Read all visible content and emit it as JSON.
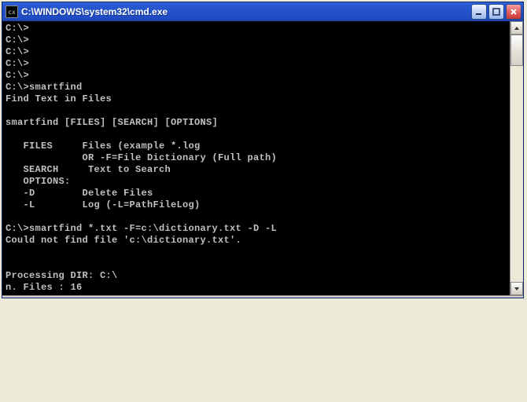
{
  "window": {
    "title": "C:\\WINDOWS\\system32\\cmd.exe",
    "icon_label": "cx"
  },
  "terminal_lines": [
    "C:\\>",
    "C:\\>",
    "C:\\>",
    "C:\\>",
    "C:\\>",
    "C:\\>smartfind",
    "Find Text in Files",
    "",
    "smartfind [FILES] [SEARCH] [OPTIONS]",
    "",
    "   FILES     Files (example *.log",
    "             OR -F=File Dictionary (Full path)",
    "   SEARCH     Text to Search",
    "   OPTIONS:",
    "   -D        Delete Files",
    "   -L        Log (-L=PathFileLog)",
    "",
    "C:\\>smartfind *.txt -F=c:\\dictionary.txt -D -L",
    "Could not find file 'c:\\dictionary.txt'.",
    "",
    "",
    "Processing DIR: C:\\",
    "n. Files : 16"
  ]
}
